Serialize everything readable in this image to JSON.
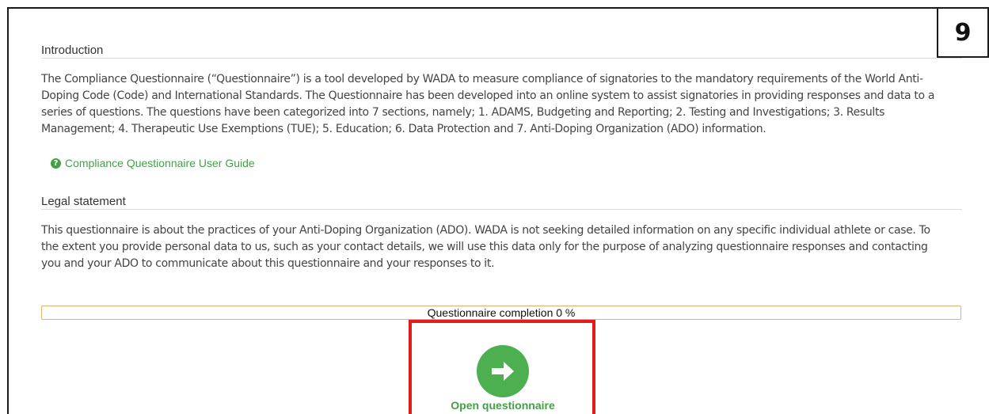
{
  "step_badge": "9",
  "introduction": {
    "title": "Introduction",
    "lines": [
      "The Compliance Questionnaire (“Questionnaire”) is a tool developed by WADA to measure compliance of signatories to the mandatory requirements of the World Anti-",
      "Doping Code (Code) and International Standards. The Questionnaire has been developed into an online system to assist signatories in providing responses and data to a",
      "series of questions. The questions have been categorized into 7 sections, namely; 1. ADAMS, Budgeting and Reporting; 2. Testing and Investigations; 3. Results",
      "Management; 4. Therapeutic Use Exemptions (TUE); 5. Education; 6. Data Protection and 7. Anti-Doping Organization (ADO) information."
    ]
  },
  "guide_link": {
    "icon": "question-circle-icon",
    "label": "Compliance Questionnaire User Guide"
  },
  "legal": {
    "title": "Legal statement",
    "lines": [
      "This questionnaire is about the practices of your Anti-Doping Organization (ADO). WADA is not seeking detailed information on any specific individual athlete or case. To",
      "the extent you provide personal data to us, such as your contact details, we will use this data only for the purpose of analyzing questionnaire responses and contacting",
      "you and your ADO to communicate about this questionnaire and your responses to it."
    ]
  },
  "progress": {
    "label": "Questionnaire completion 0 %",
    "percent": 0
  },
  "open_button": {
    "icon": "arrow-right-circle-icon",
    "label": "Open questionnaire"
  },
  "colors": {
    "accent_green": "#4caf50",
    "link_green": "#43a047",
    "highlight_red": "#e31b1b",
    "progress_border": "#e0b070"
  }
}
